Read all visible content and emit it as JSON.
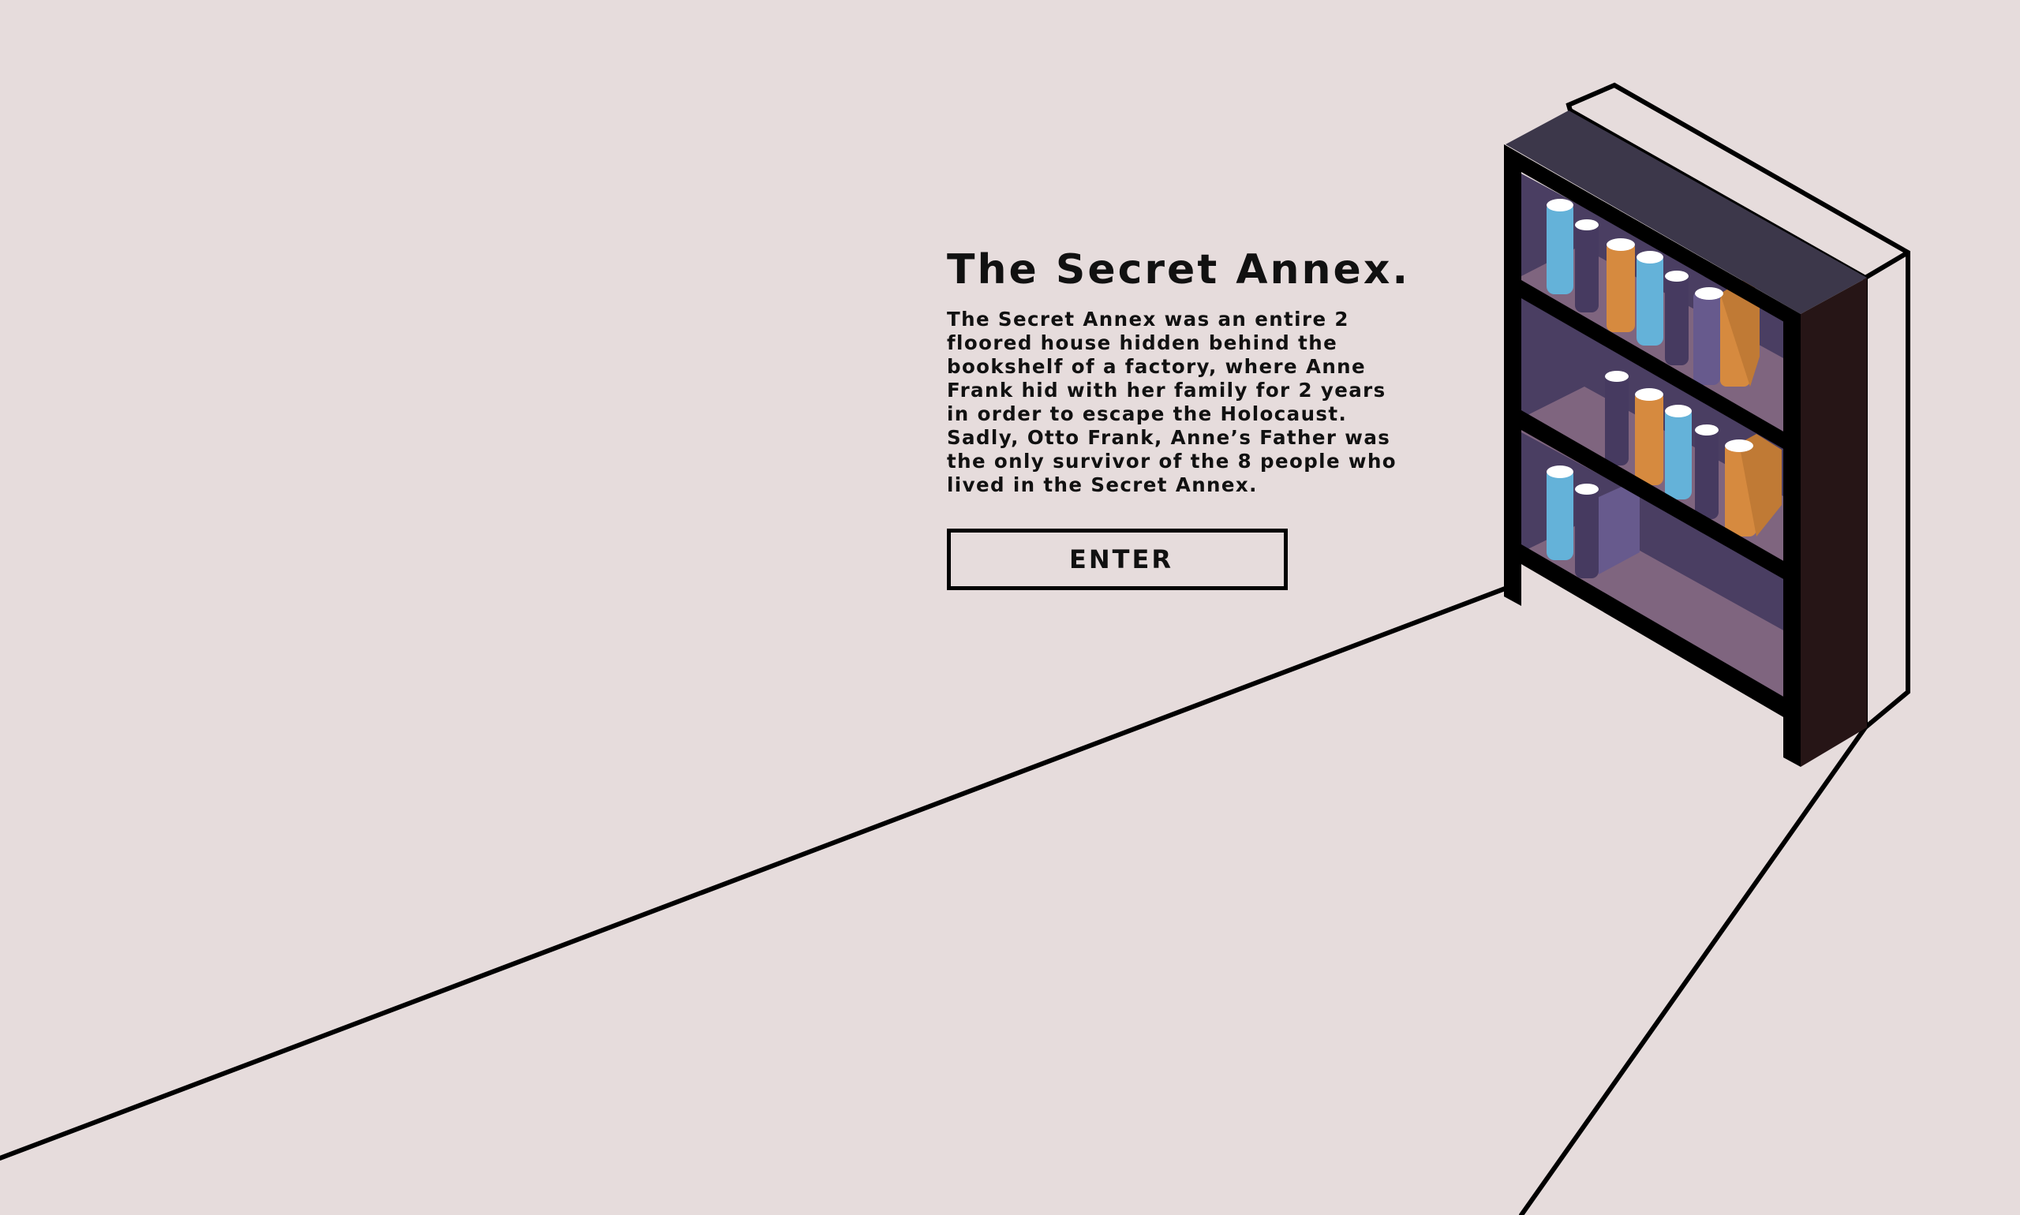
{
  "hero": {
    "title": "The Secret Annex.",
    "description": "The Secret Annex was an entire 2 floored house hidden behind the bookshelf of a factory, where Anne Frank hid with her family for 2 years in order to escape the Holocaust. Sadly, Otto Frank, Anne’s Father was the only survivor of the 8 people who lived in the Secret Annex.",
    "enter_label": "ENTER"
  },
  "colors": {
    "background": "#e6dcdc",
    "outline": "#000000",
    "shelf_top": "#3c374a",
    "shelf_side": "#261516",
    "shelf_back": "#4a3e62",
    "shelf_floor": "#7f657f",
    "book_blue": "#64b2d9",
    "book_purple": "#463a60",
    "book_violet": "#675a8d",
    "book_orange": "#d68a3f"
  },
  "illustration": {
    "subject": "bookshelf-doorway",
    "icons": [
      "bookshelf-icon",
      "book-icon",
      "doorframe-icon",
      "floor-line-icon"
    ]
  }
}
